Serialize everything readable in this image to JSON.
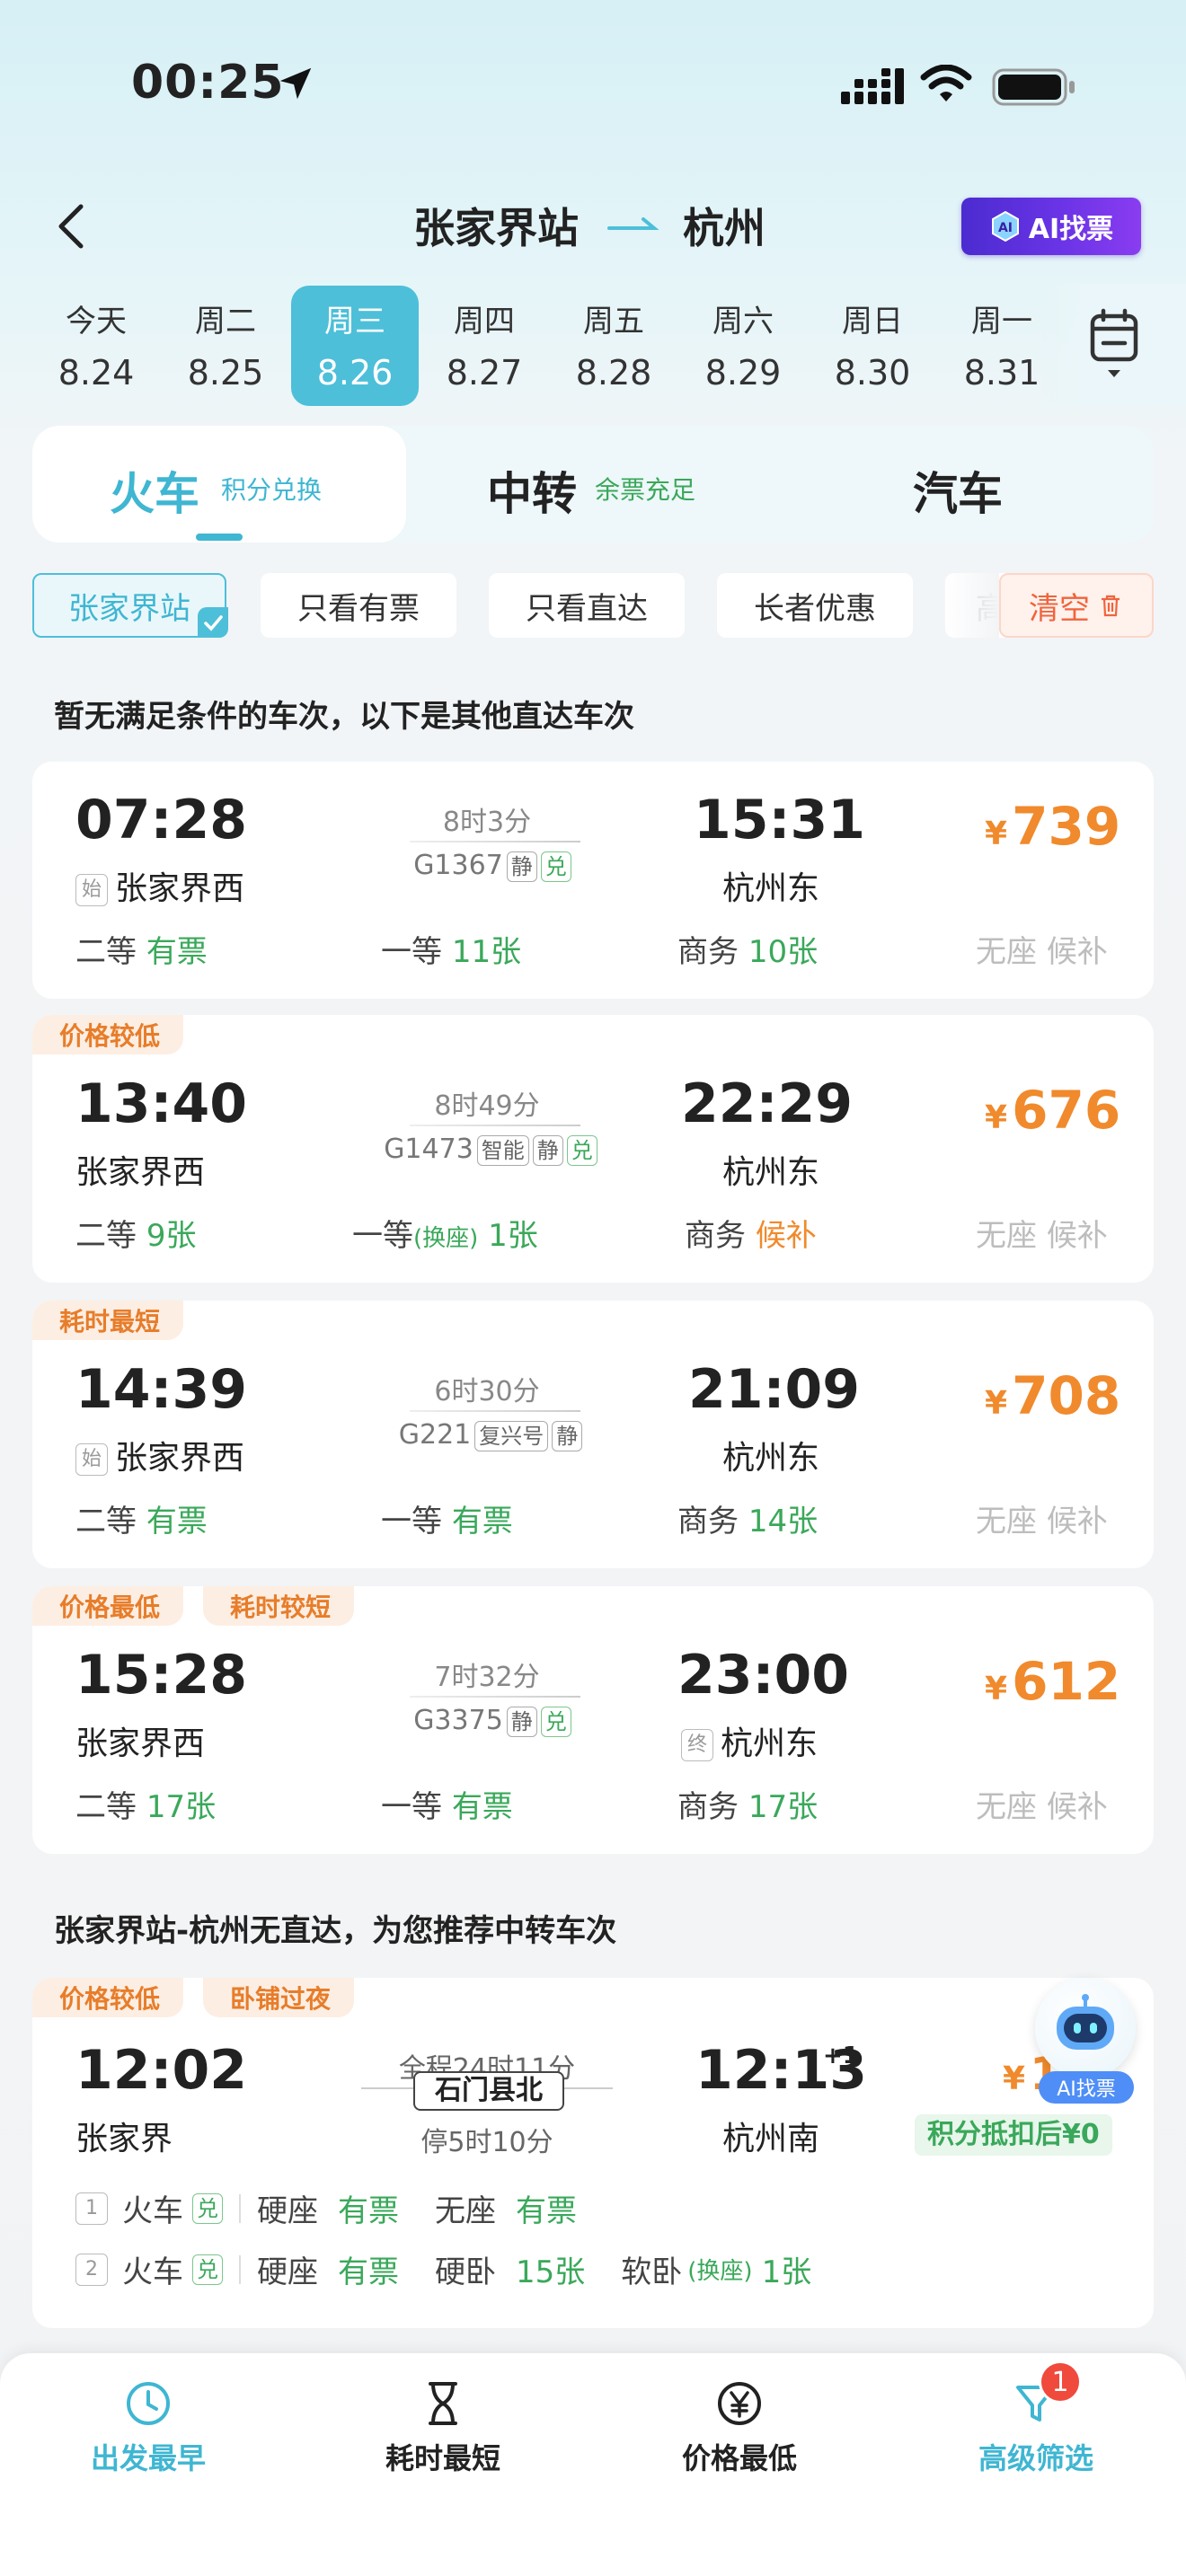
{
  "status": {
    "time": "00:25"
  },
  "nav": {
    "from": "张家界站",
    "to": "杭州",
    "ai_label": "AI找票",
    "ai_badge": "AI"
  },
  "dates": [
    {
      "weekday": "今天",
      "date": "8.24"
    },
    {
      "weekday": "周二",
      "date": "8.25"
    },
    {
      "weekday": "周三",
      "date": "8.26",
      "active": true
    },
    {
      "weekday": "周四",
      "date": "8.27"
    },
    {
      "weekday": "周五",
      "date": "8.28"
    },
    {
      "weekday": "周六",
      "date": "8.29"
    },
    {
      "weekday": "周日",
      "date": "8.30"
    },
    {
      "weekday": "周一",
      "date": "8.31"
    }
  ],
  "modes": {
    "train": "火车",
    "train_sub": "积分兑换",
    "transfer": "中转",
    "transfer_sub": "余票充足",
    "bus": "汽车"
  },
  "filters": {
    "station": "张家界站",
    "has_ticket": "只看有票",
    "direct": "只看直达",
    "senior": "长者优惠",
    "more": "高",
    "clear": "清空"
  },
  "notice": "暂无满足条件的车次，以下是其他直达车次",
  "trains": [
    {
      "tags": [],
      "dep_time": "07:28",
      "dep_badge": "始",
      "dep_station": "张家界西",
      "duration": "8时3分",
      "train_no": "G1367",
      "badges": [
        "静",
        "兑"
      ],
      "arr_time": "15:31",
      "arr_badge": "",
      "arr_station": "杭州东",
      "yen": "¥",
      "price": "739",
      "seat1_name": "二等",
      "seat1_val": "有票",
      "seat2_name": "一等",
      "seat2_extra": "",
      "seat2_val": "11张",
      "seat3_name": "商务",
      "seat3_val": "10张",
      "noseat": "无座",
      "waitlist": "候补"
    },
    {
      "tags": [
        "价格较低"
      ],
      "dep_time": "13:40",
      "dep_badge": "",
      "dep_station": "张家界西",
      "duration": "8时49分",
      "train_no": "G1473",
      "badges": [
        "智能",
        "静",
        "兑"
      ],
      "arr_time": "22:29",
      "arr_badge": "",
      "arr_station": "杭州东",
      "yen": "¥",
      "price": "676",
      "seat1_name": "二等",
      "seat1_val": "9张",
      "seat2_name": "一等",
      "seat2_extra": "(换座)",
      "seat2_val": "1张",
      "seat3_name": "商务",
      "seat3_val": "候补",
      "noseat": "无座",
      "waitlist": "候补"
    },
    {
      "tags": [
        "耗时最短"
      ],
      "dep_time": "14:39",
      "dep_badge": "始",
      "dep_station": "张家界西",
      "duration": "6时30分",
      "train_no": "G221",
      "badges": [
        "复兴号",
        "静"
      ],
      "arr_time": "21:09",
      "arr_badge": "",
      "arr_station": "杭州东",
      "yen": "¥",
      "price": "708",
      "seat1_name": "二等",
      "seat1_val": "有票",
      "seat2_name": "一等",
      "seat2_extra": "",
      "seat2_val": "有票",
      "seat3_name": "商务",
      "seat3_val": "14张",
      "noseat": "无座",
      "waitlist": "候补"
    },
    {
      "tags": [
        "价格最低",
        "耗时较短"
      ],
      "dep_time": "15:28",
      "dep_badge": "",
      "dep_station": "张家界西",
      "duration": "7时32分",
      "train_no": "G3375",
      "badges": [
        "静",
        "兑"
      ],
      "arr_time": "23:00",
      "arr_badge": "终",
      "arr_station": "杭州东",
      "yen": "¥",
      "price": "612",
      "seat1_name": "二等",
      "seat1_val": "17张",
      "seat2_name": "一等",
      "seat2_extra": "",
      "seat2_val": "有票",
      "seat3_name": "商务",
      "seat3_val": "17张",
      "noseat": "无座",
      "waitlist": "候补"
    }
  ],
  "transfer_notice": "张家界站-杭州无直达，为您推荐中转车次",
  "transfer": {
    "tags": [
      "价格较低",
      "卧铺过夜"
    ],
    "dep_time": "12:02",
    "dep_station": "张家界",
    "total": "全程24时11分",
    "via": "石门县北",
    "stop": "停5时10分",
    "arr_time": "12:13",
    "arr_plus": "+1",
    "arr_station": "杭州南",
    "yen": "¥",
    "price_partial": "1",
    "points_note": "积分抵扣后¥0",
    "legs": [
      {
        "no": "1",
        "type": "火车",
        "badge": "兑",
        "s1": "硬座",
        "v1": "有票",
        "s2": "无座",
        "v2": "有票",
        "s3": "",
        "x3": "",
        "v3": ""
      },
      {
        "no": "2",
        "type": "火车",
        "badge": "兑",
        "s1": "硬座",
        "v1": "有票",
        "s2": "硬卧",
        "v2": "15张",
        "s3": "软卧",
        "x3": "(换座)",
        "v3": "1张"
      }
    ]
  },
  "robot_label": "AI找票",
  "bottom": {
    "earliest": "出发最早",
    "shortest": "耗时最短",
    "cheapest": "价格最低",
    "advanced": "高级筛选",
    "badge_count": "1"
  },
  "colors": {
    "accent": "#4dbfd9",
    "price": "#f08a2c",
    "green": "#3aa85a",
    "tag_bg": "#fdeee3"
  }
}
